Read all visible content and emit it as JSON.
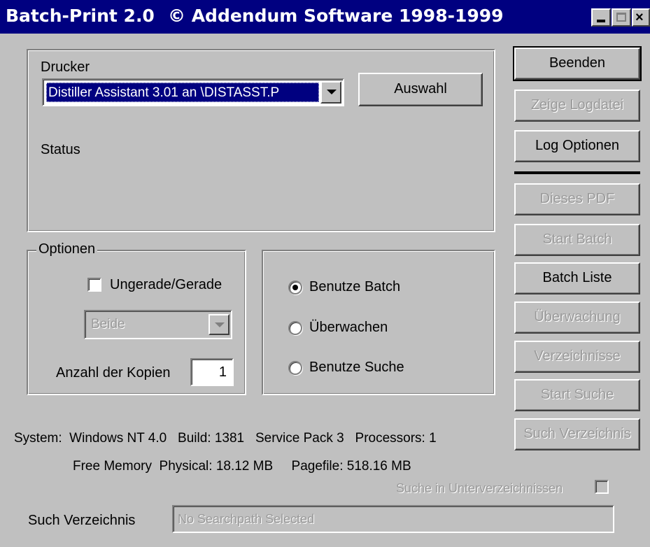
{
  "window": {
    "title": "Batch-Print 2.0",
    "copyright": "© Addendum Software 1998-1999",
    "controls": {
      "minimize": "_",
      "maximize": "□",
      "close": "X"
    }
  },
  "printer_group": {
    "label": "Drucker",
    "selected_printer": "Distiller Assistant 3.01 an \\DISTASST.P",
    "select_button": "Auswahl",
    "status_label": "Status"
  },
  "options_group": {
    "legend": "Optionen",
    "odd_even_label": "Ungerade/Gerade",
    "odd_even_checked": false,
    "pages_selection": "Beide",
    "copies_label": "Anzahl der Kopien",
    "copies_value": "1"
  },
  "mode_group": {
    "options": [
      {
        "label": "Benutze Batch",
        "selected": true
      },
      {
        "label": "Überwachen",
        "selected": false
      },
      {
        "label": "Benutze Suche",
        "selected": false
      }
    ]
  },
  "buttons": {
    "beenden": "Beenden",
    "zeige_logdatei": "Zeige Logdatei",
    "log_optionen": "Log Optionen",
    "dieses_pdf": "Dieses PDF",
    "start_batch": "Start Batch",
    "batch_liste": "Batch Liste",
    "ueberwachung": "Überwachung",
    "verzeichnisse": "Verzeichnisse",
    "start_suche": "Start Suche",
    "such_verzeichnis": "Such Verzeichnis"
  },
  "system_info": {
    "line1": "System:  Windows NT 4.0   Build: 1381   Service Pack 3   Processors: 1",
    "line2": "Free Memory  Physical: 18.12 MB     Pagefile: 518.16 MB"
  },
  "search": {
    "subdirs_label": "Suche in Unterverzeichnissen",
    "subdirs_checked": false,
    "dir_label": "Such Verzeichnis",
    "dir_value": "No Searchpath Selected"
  },
  "colors": {
    "titlebar": "#000080",
    "face": "#c0c0c0",
    "selection": "#000080"
  }
}
